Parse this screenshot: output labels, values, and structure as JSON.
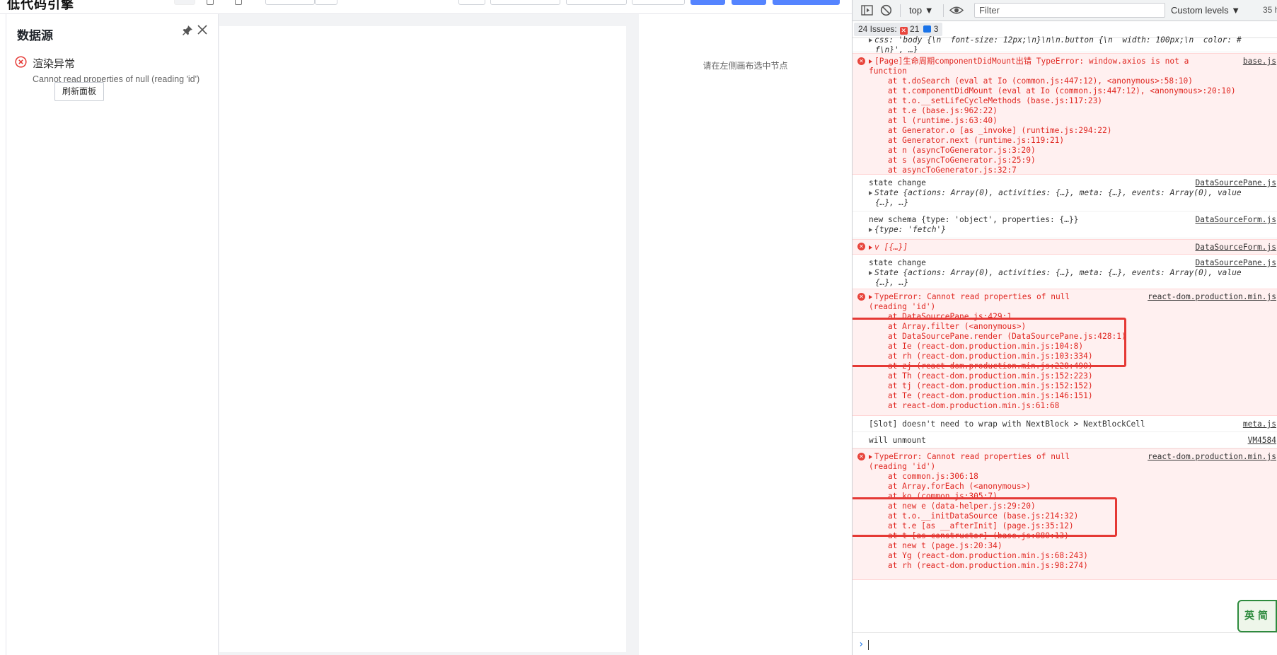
{
  "app": {
    "logo_text": "低代码引擎",
    "panel": {
      "title": "数据源",
      "error_title": "渲染异常",
      "error_message": "Cannot read properties of null (reading 'id')",
      "refresh_label": "刷新面板"
    },
    "settings_hint": "请在左侧画布选中节点"
  },
  "devtools": {
    "context_label": "top",
    "filter_placeholder": "Filter",
    "levels_label": "Custom levels",
    "hidden_count": "35 h",
    "issues_label": "24 Issues:",
    "issues_error_count": "21",
    "issues_info_count": "3",
    "messages": [
      {
        "type": "log",
        "lines": [
          "css: 'body {\\n  font-size: 12px;\\n}\\n\\n.button {\\n  width: 100px;\\n  color: #",
          "f\\n}', …}"
        ],
        "source": ""
      },
      {
        "type": "error",
        "lines": [
          "[Page]生命周期componentDidMount出错 TypeError: window.axios is not a",
          "function",
          "    at t.doSearch (eval at Io (common.js:447:12), <anonymous>:58:10)",
          "    at t.componentDidMount (eval at Io (common.js:447:12), <anonymous>:20:10)",
          "    at t.o.__setLifeCycleMethods (base.js:117:23)",
          "    at t.e (base.js:962:22)",
          "    at l (runtime.js:63:40)",
          "    at Generator.o [as _invoke] (runtime.js:294:22)",
          "    at Generator.next (runtime.js:119:21)",
          "    at n (asyncToGenerator.js:3:20)",
          "    at s (asyncToGenerator.js:25:9)",
          "    at asyncToGenerator.js:32:7"
        ],
        "source": "base.js"
      },
      {
        "type": "log",
        "lines": [
          "state change",
          "State {actions: Array(0), activities: {…}, meta: {…}, events: Array(0), value",
          "{…}, …}"
        ],
        "source": "DataSourcePane.js"
      },
      {
        "type": "log",
        "lines": [
          "new schema {type: 'object', properties: {…}}",
          "{type: 'fetch'}"
        ],
        "source": "DataSourceForm.js"
      },
      {
        "type": "error",
        "lines": [
          "v [{…}]"
        ],
        "source": "DataSourceForm.js"
      },
      {
        "type": "log",
        "lines": [
          "state change",
          "State {actions: Array(0), activities: {…}, meta: {…}, events: Array(0), value",
          "{…}, …}"
        ],
        "source": "DataSourcePane.js"
      },
      {
        "type": "error",
        "lines": [
          "TypeError: Cannot read properties of null",
          "(reading 'id')",
          "    at DataSourcePane.js:429:1",
          "    at Array.filter (<anonymous>)",
          "    at DataSourcePane.render (DataSourcePane.js:428:1)",
          "    at Ie (react-dom.production.min.js:104:8)",
          "    at rh (react-dom.production.min.js:103:334)",
          "    at zj (react-dom.production.min.js:228:490)",
          "    at Th (react-dom.production.min.js:152:223)",
          "    at tj (react-dom.production.min.js:152:152)",
          "    at Te (react-dom.production.min.js:146:151)",
          "    at react-dom.production.min.js:61:68"
        ],
        "source": "react-dom.production.min.js"
      },
      {
        "type": "log",
        "lines": [
          "[Slot] doesn't need to wrap with NextBlock > NextBlockCell"
        ],
        "source": "meta.js"
      },
      {
        "type": "log",
        "lines": [
          "will unmount"
        ],
        "source": "VM4584"
      },
      {
        "type": "error",
        "lines": [
          "TypeError: Cannot read properties of null",
          "(reading 'id')",
          "    at common.js:306:18",
          "    at Array.forEach (<anonymous>)",
          "    at ko (common.js:305:7)",
          "    at new e (data-helper.js:29:20)",
          "    at t.o.__initDataSource (base.js:214:32)",
          "    at t.e [as __afterInit] (page.js:35:12)",
          "    at t [as constructor] (base.js:880:13)",
          "    at new t (page.js:20:34)",
          "    at Yg (react-dom.production.min.js:68:243)",
          "    at rh (react-dom.production.min.js:98:274)"
        ],
        "source": "react-dom.production.min.js"
      }
    ]
  },
  "ime": {
    "label": "英 简"
  },
  "colors": {
    "primary": "#5584ff",
    "error": "#e02822",
    "highlight": "#e53935"
  }
}
